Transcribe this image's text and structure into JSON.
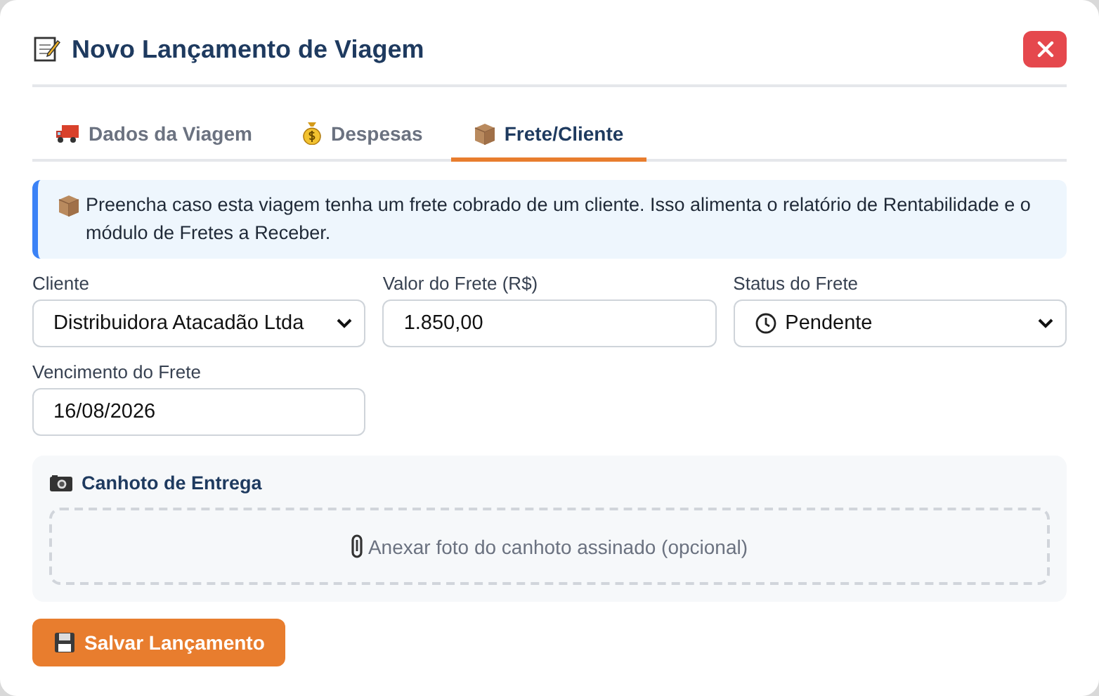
{
  "dialog": {
    "title": "Novo Lançamento de Viagem"
  },
  "tabs": [
    {
      "label": "Dados da Viagem",
      "selected": false
    },
    {
      "label": "Despesas",
      "selected": false
    },
    {
      "label": "Frete/Cliente",
      "selected": true
    }
  ],
  "info": "Preencha caso esta viagem tenha um frete cobrado de um cliente. Isso alimenta o relatório de Rentabilidade e o módulo de Fretes a Receber.",
  "fields": [
    {
      "label": "Cliente",
      "kind": "select",
      "value": "Distribuidora Atacadão Ltda"
    },
    {
      "label": "Valor do Frete (R$)",
      "kind": "input",
      "value": "1.850,00"
    },
    {
      "label": "Status do Frete",
      "kind": "select",
      "value": "Pendente"
    },
    {
      "label": "Vencimento do Frete",
      "kind": "input",
      "value": "16/08/2026"
    }
  ],
  "receipt": {
    "title": "Canhoto de Entrega",
    "dropzone": "Anexar foto do canhoto assinado (opcional)"
  },
  "save_button": "Salvar Lançamento"
}
